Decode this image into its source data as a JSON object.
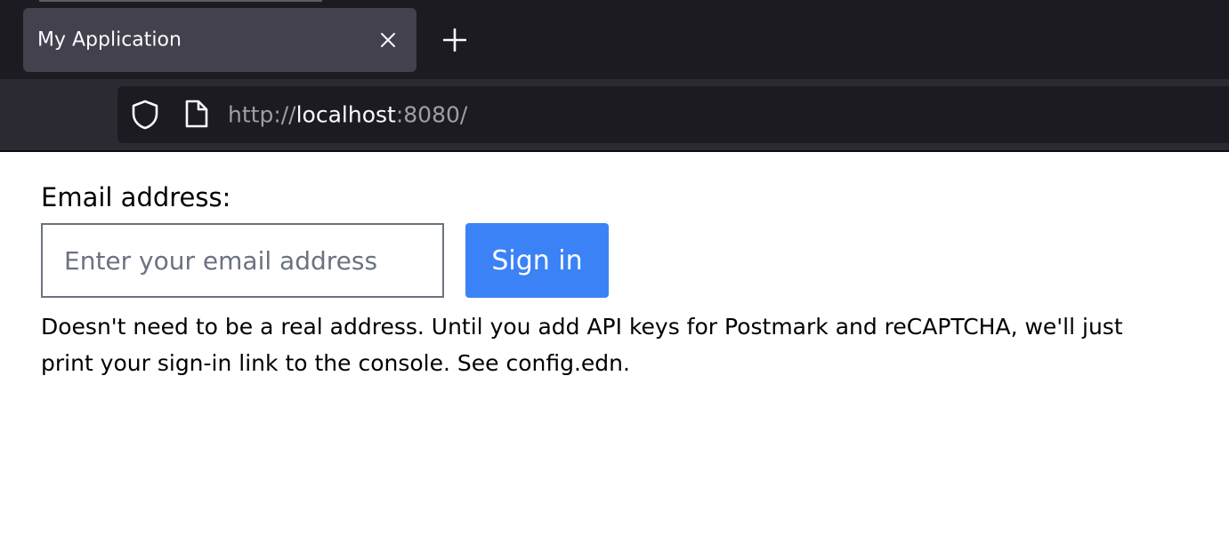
{
  "browser": {
    "tab": {
      "title": "My Application"
    },
    "url": {
      "scheme": "http://",
      "host": "localhost",
      "rest": ":8080/"
    },
    "icons": {
      "shield": "shield-icon",
      "page": "page-icon",
      "close": "close-icon",
      "new_tab": "plus-icon"
    },
    "colors": {
      "tabbar": "#1c1b22",
      "active_tab": "#42414d",
      "navbar": "#2b2a33",
      "urlbar": "#1c1b22"
    }
  },
  "form": {
    "label": "Email address:",
    "email_placeholder": "Enter your email address",
    "email_value": "",
    "submit_label": "Sign in",
    "help_text": "Doesn't need to be a real address. Until you add API keys for Postmark and reCAPTCHA, we'll just print your sign-in link to the console. See config.edn."
  },
  "colors": {
    "accent": "#3b82f6",
    "input_border": "#6b7280"
  }
}
